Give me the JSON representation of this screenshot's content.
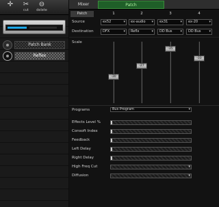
{
  "toolbar": {
    "add_label": "",
    "cut_label": "cut",
    "delete_label": "delete"
  },
  "rack": {
    "slots": [
      {
        "label": "Patch Bank",
        "active": false
      },
      {
        "label": "Reflex",
        "active": true
      }
    ]
  },
  "tabs": {
    "mixer": "Mixer",
    "patch": "Patch"
  },
  "patch_grid": {
    "header": "Patch",
    "columns": [
      "1",
      "2",
      "3",
      "4"
    ],
    "source_label": "Source",
    "sources": [
      "ex52",
      "ex-audio",
      "ex31",
      "ex-20"
    ],
    "destination_label": "Destination",
    "destinations": [
      "DFX",
      "Reflx",
      "DD Bus",
      "DD Bus"
    ],
    "scale_label": "Scale",
    "scales": [
      "-30",
      "-27",
      "-35",
      "-33"
    ],
    "scale_levels": [
      0.42,
      0.62,
      0.93,
      0.75
    ]
  },
  "params": {
    "program_label": "Programs",
    "program_value": "Bus Program",
    "rows": [
      {
        "label": "Effects Level %",
        "value": 0.02
      },
      {
        "label": "Consoft Index",
        "value": 0.02
      },
      {
        "label": "Feedback",
        "value": 0.02
      },
      {
        "label": "Left Delay",
        "value": 0.02
      },
      {
        "label": "Right Delay",
        "value": 0.02
      },
      {
        "label": "High Freq Cut",
        "value": 0.0
      },
      {
        "label": "Diffusion",
        "value": 0.0
      }
    ]
  },
  "colors": {
    "accent": "#1ba7e8",
    "tab_active": "#1f5f28"
  }
}
